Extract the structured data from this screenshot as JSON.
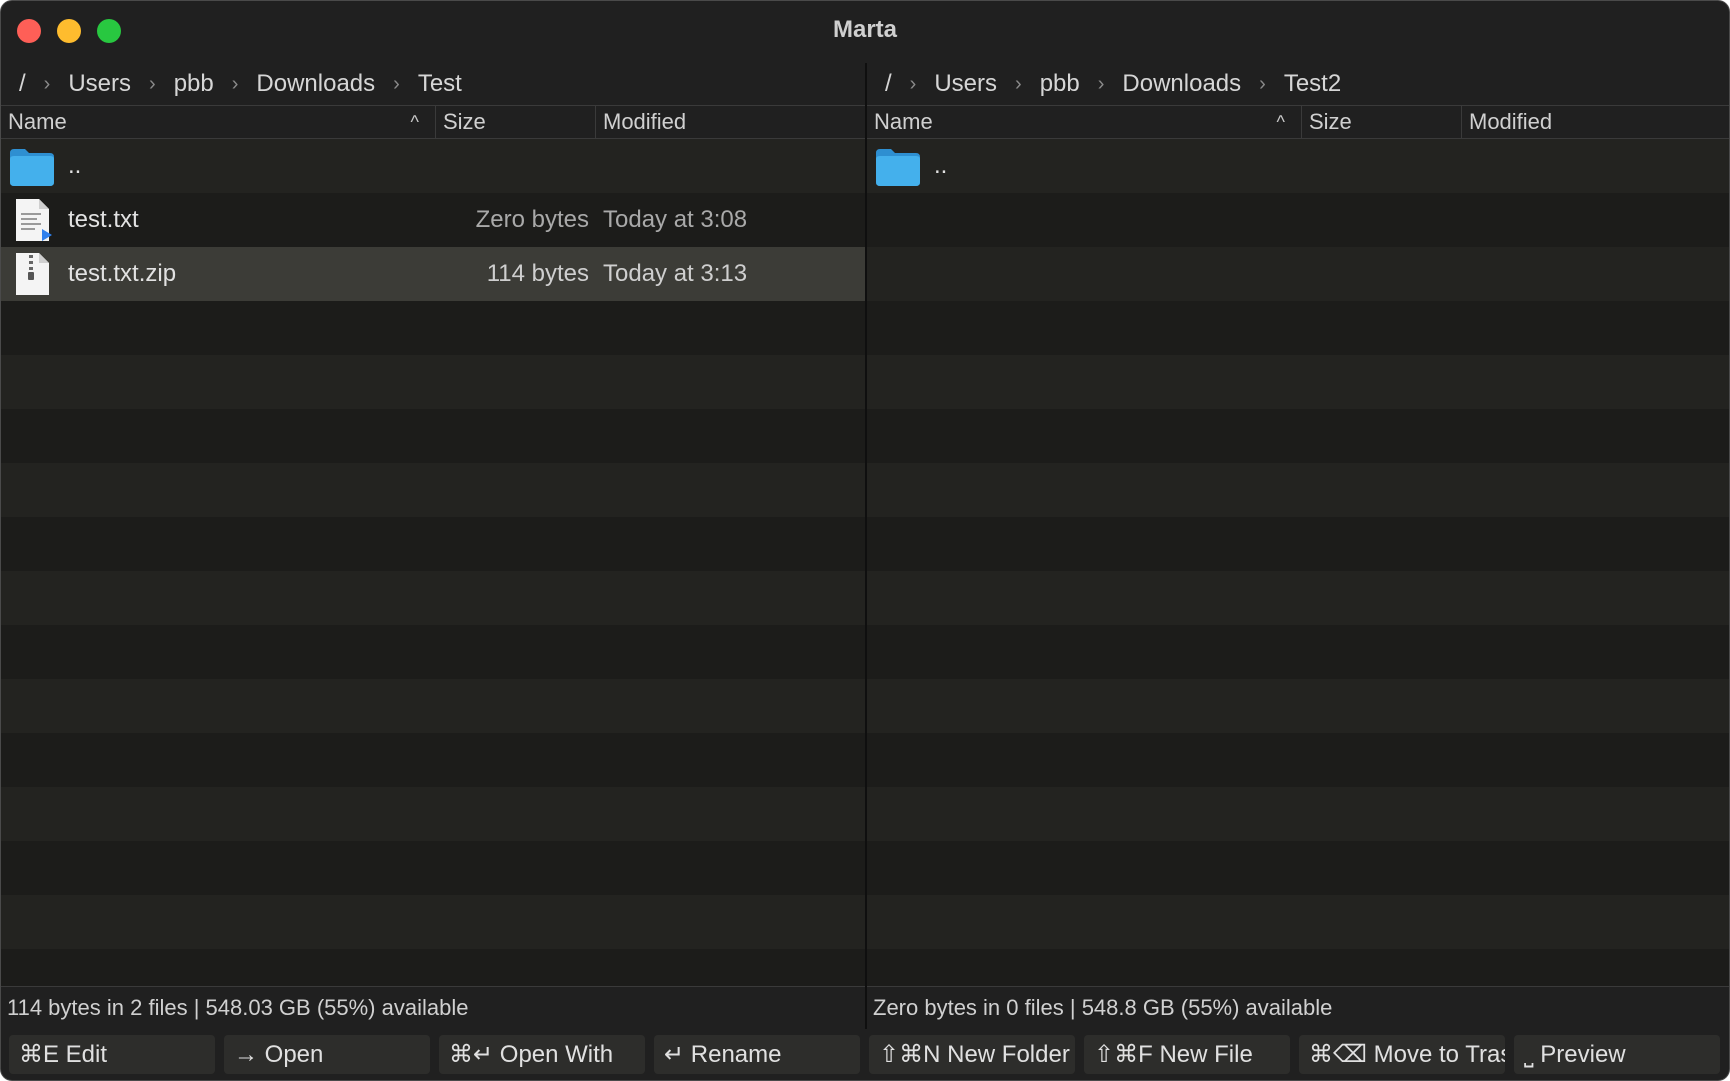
{
  "window": {
    "title": "Marta"
  },
  "left_pane": {
    "breadcrumb": [
      "/",
      "Users",
      "pbb",
      "Downloads",
      "Test"
    ],
    "columns": {
      "name": "Name",
      "size": "Size",
      "modified": "Modified"
    },
    "rows": [
      {
        "icon": "folder-icon",
        "name": "..",
        "size": "",
        "modified": ""
      },
      {
        "icon": "text-file-icon",
        "name": "test.txt",
        "size": "Zero bytes",
        "modified": "Today at 3:08"
      },
      {
        "icon": "zip-file-icon",
        "name": "test.txt.zip",
        "size": "114 bytes",
        "modified": "Today at 3:13",
        "selected": true
      }
    ],
    "status": "114 bytes in 2 files  |  548.03 GB (55%) available"
  },
  "right_pane": {
    "breadcrumb": [
      "/",
      "Users",
      "pbb",
      "Downloads",
      "Test2"
    ],
    "columns": {
      "name": "Name",
      "size": "Size",
      "modified": "Modified"
    },
    "rows": [
      {
        "icon": "folder-icon",
        "name": "..",
        "size": "",
        "modified": ""
      }
    ],
    "status": "Zero bytes in 0 files  |  548.8 GB (55%) available"
  },
  "function_bar": [
    {
      "label": "⌘E Edit"
    },
    {
      "label": "→ Open"
    },
    {
      "label": "⌘↵ Open With"
    },
    {
      "label": "↵ Rename"
    },
    {
      "label": "⇧⌘N New Folder"
    },
    {
      "label": "⇧⌘F New File"
    },
    {
      "label": "⌘⌫ Move to Trash"
    },
    {
      "label": "⎵ Preview"
    }
  ],
  "colors": {
    "window_bg": "#202020",
    "selected_row": "#3c3c37",
    "folder_blue": "#3fa9e4"
  }
}
